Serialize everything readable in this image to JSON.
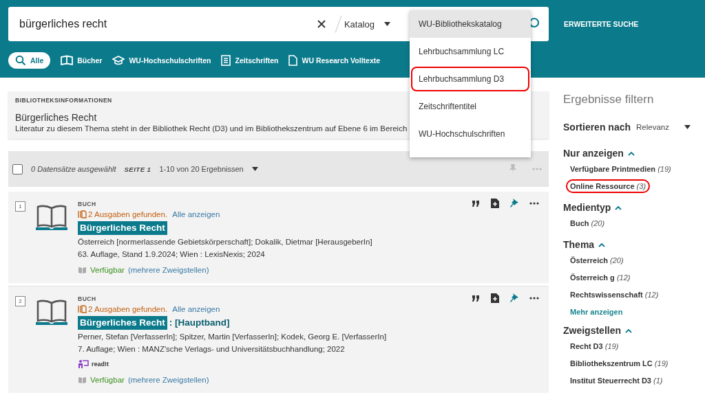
{
  "search": {
    "value": "bürgerliches recht",
    "scope": "Katalog"
  },
  "scope_dropdown": {
    "items": [
      {
        "label": "WU-Bibliothekskatalog",
        "selected": true,
        "highlighted": false
      },
      {
        "label": "Lehrbuchsammlung LC",
        "selected": false,
        "highlighted": false
      },
      {
        "label": "Lehrbuchsammlung D3",
        "selected": false,
        "highlighted": true
      },
      {
        "label": "Zeitschriftentitel",
        "selected": false,
        "highlighted": false
      },
      {
        "label": "WU-Hochschulschriften",
        "selected": false,
        "highlighted": false
      }
    ]
  },
  "advanced_search": "ERWEITERTE SUCHE",
  "tabs": [
    {
      "label": "Alle",
      "selected": true,
      "kind": "search"
    },
    {
      "label": "Bücher",
      "selected": false,
      "kind": "book"
    },
    {
      "label": "WU-Hochschulschriften",
      "selected": false,
      "kind": "cap"
    },
    {
      "label": "Zeitschriften",
      "selected": false,
      "kind": "journal"
    },
    {
      "label": "WU Research Volltexte",
      "selected": false,
      "kind": "doc"
    }
  ],
  "library_info": {
    "heading": "BIBLIOTHEKSINFORMATIONEN",
    "title": "Bürgerliches Recht",
    "text": "Literatur zu diesem Thema steht in der Bibliothek Recht (D3) und im Bibliothekszentrum auf Ebene 6 im Bereich"
  },
  "results_toolbar": {
    "checked": false,
    "selected_count": "0 Datensätze ausgewählt",
    "page": "SEITE 1",
    "range": "1-10 von 20 Ergebnissen"
  },
  "results": [
    {
      "number": "1",
      "type": "BUCH",
      "editions": "2 Ausgaben gefunden.",
      "show_all": "Alle anzeigen",
      "title": "Bürgerliches Recht",
      "authors": "Österreich [normerlassende Gebietskörperschaft]; Dokalik, Dietmar [HerausgeberIn]",
      "publication": "63. Auflage, Stand 1.9.2024; Wien : LexisNexis; 2024",
      "availability": "Verfügbar",
      "branches": "(mehrere Zweigstellen)"
    },
    {
      "number": "2",
      "type": "BUCH",
      "editions": "2 Ausgaben gefunden.",
      "show_all": "Alle anzeigen",
      "title": "Bürgerliches Recht",
      "subtitle": ": [Hauptband]",
      "authors": "Perner, Stefan [VerfasserIn]; Spitzer, Martin [VerfasserIn]; Kodek, Georg E. [VerfasserIn]",
      "publication": "7. Auflage; Wien : MANZ'sche Verlags- und Universitätsbuchhandlung; 2022",
      "readit": "read!t",
      "availability": "Verfügbar",
      "branches": "(mehrere Zweigstellen)"
    }
  ],
  "filter_panel": {
    "title": "Ergebnisse filtern",
    "sort_label": "Sortieren nach",
    "sort_value": "Relevanz",
    "sections": [
      {
        "title": "Nur anzeigen",
        "expanded": true,
        "items": [
          {
            "label": "Verfügbare Printmedien",
            "count": "(19)",
            "highlighted": false
          },
          {
            "label": "Online Ressource",
            "count": "(3)",
            "highlighted": true
          }
        ]
      },
      {
        "title": "Medientyp",
        "expanded": true,
        "items": [
          {
            "label": "Buch",
            "count": "(20)",
            "highlighted": false
          }
        ]
      },
      {
        "title": "Thema",
        "expanded": true,
        "items": [
          {
            "label": "Österreich",
            "count": "(20)",
            "highlighted": false
          },
          {
            "label": "Österreich g",
            "count": "(12)",
            "highlighted": false
          },
          {
            "label": "Rechtswissenschaft",
            "count": "(12)",
            "highlighted": false
          }
        ],
        "more": "Mehr anzeigen"
      },
      {
        "title": "Zweigstellen",
        "expanded": true,
        "items": [
          {
            "label": "Recht D3",
            "count": "(19)",
            "highlighted": false
          },
          {
            "label": "Bibliothekszentrum LC",
            "count": "(19)",
            "highlighted": false
          },
          {
            "label": "Institut Steuerrecht D3",
            "count": "(1)",
            "highlighted": false
          }
        ]
      }
    ]
  }
}
